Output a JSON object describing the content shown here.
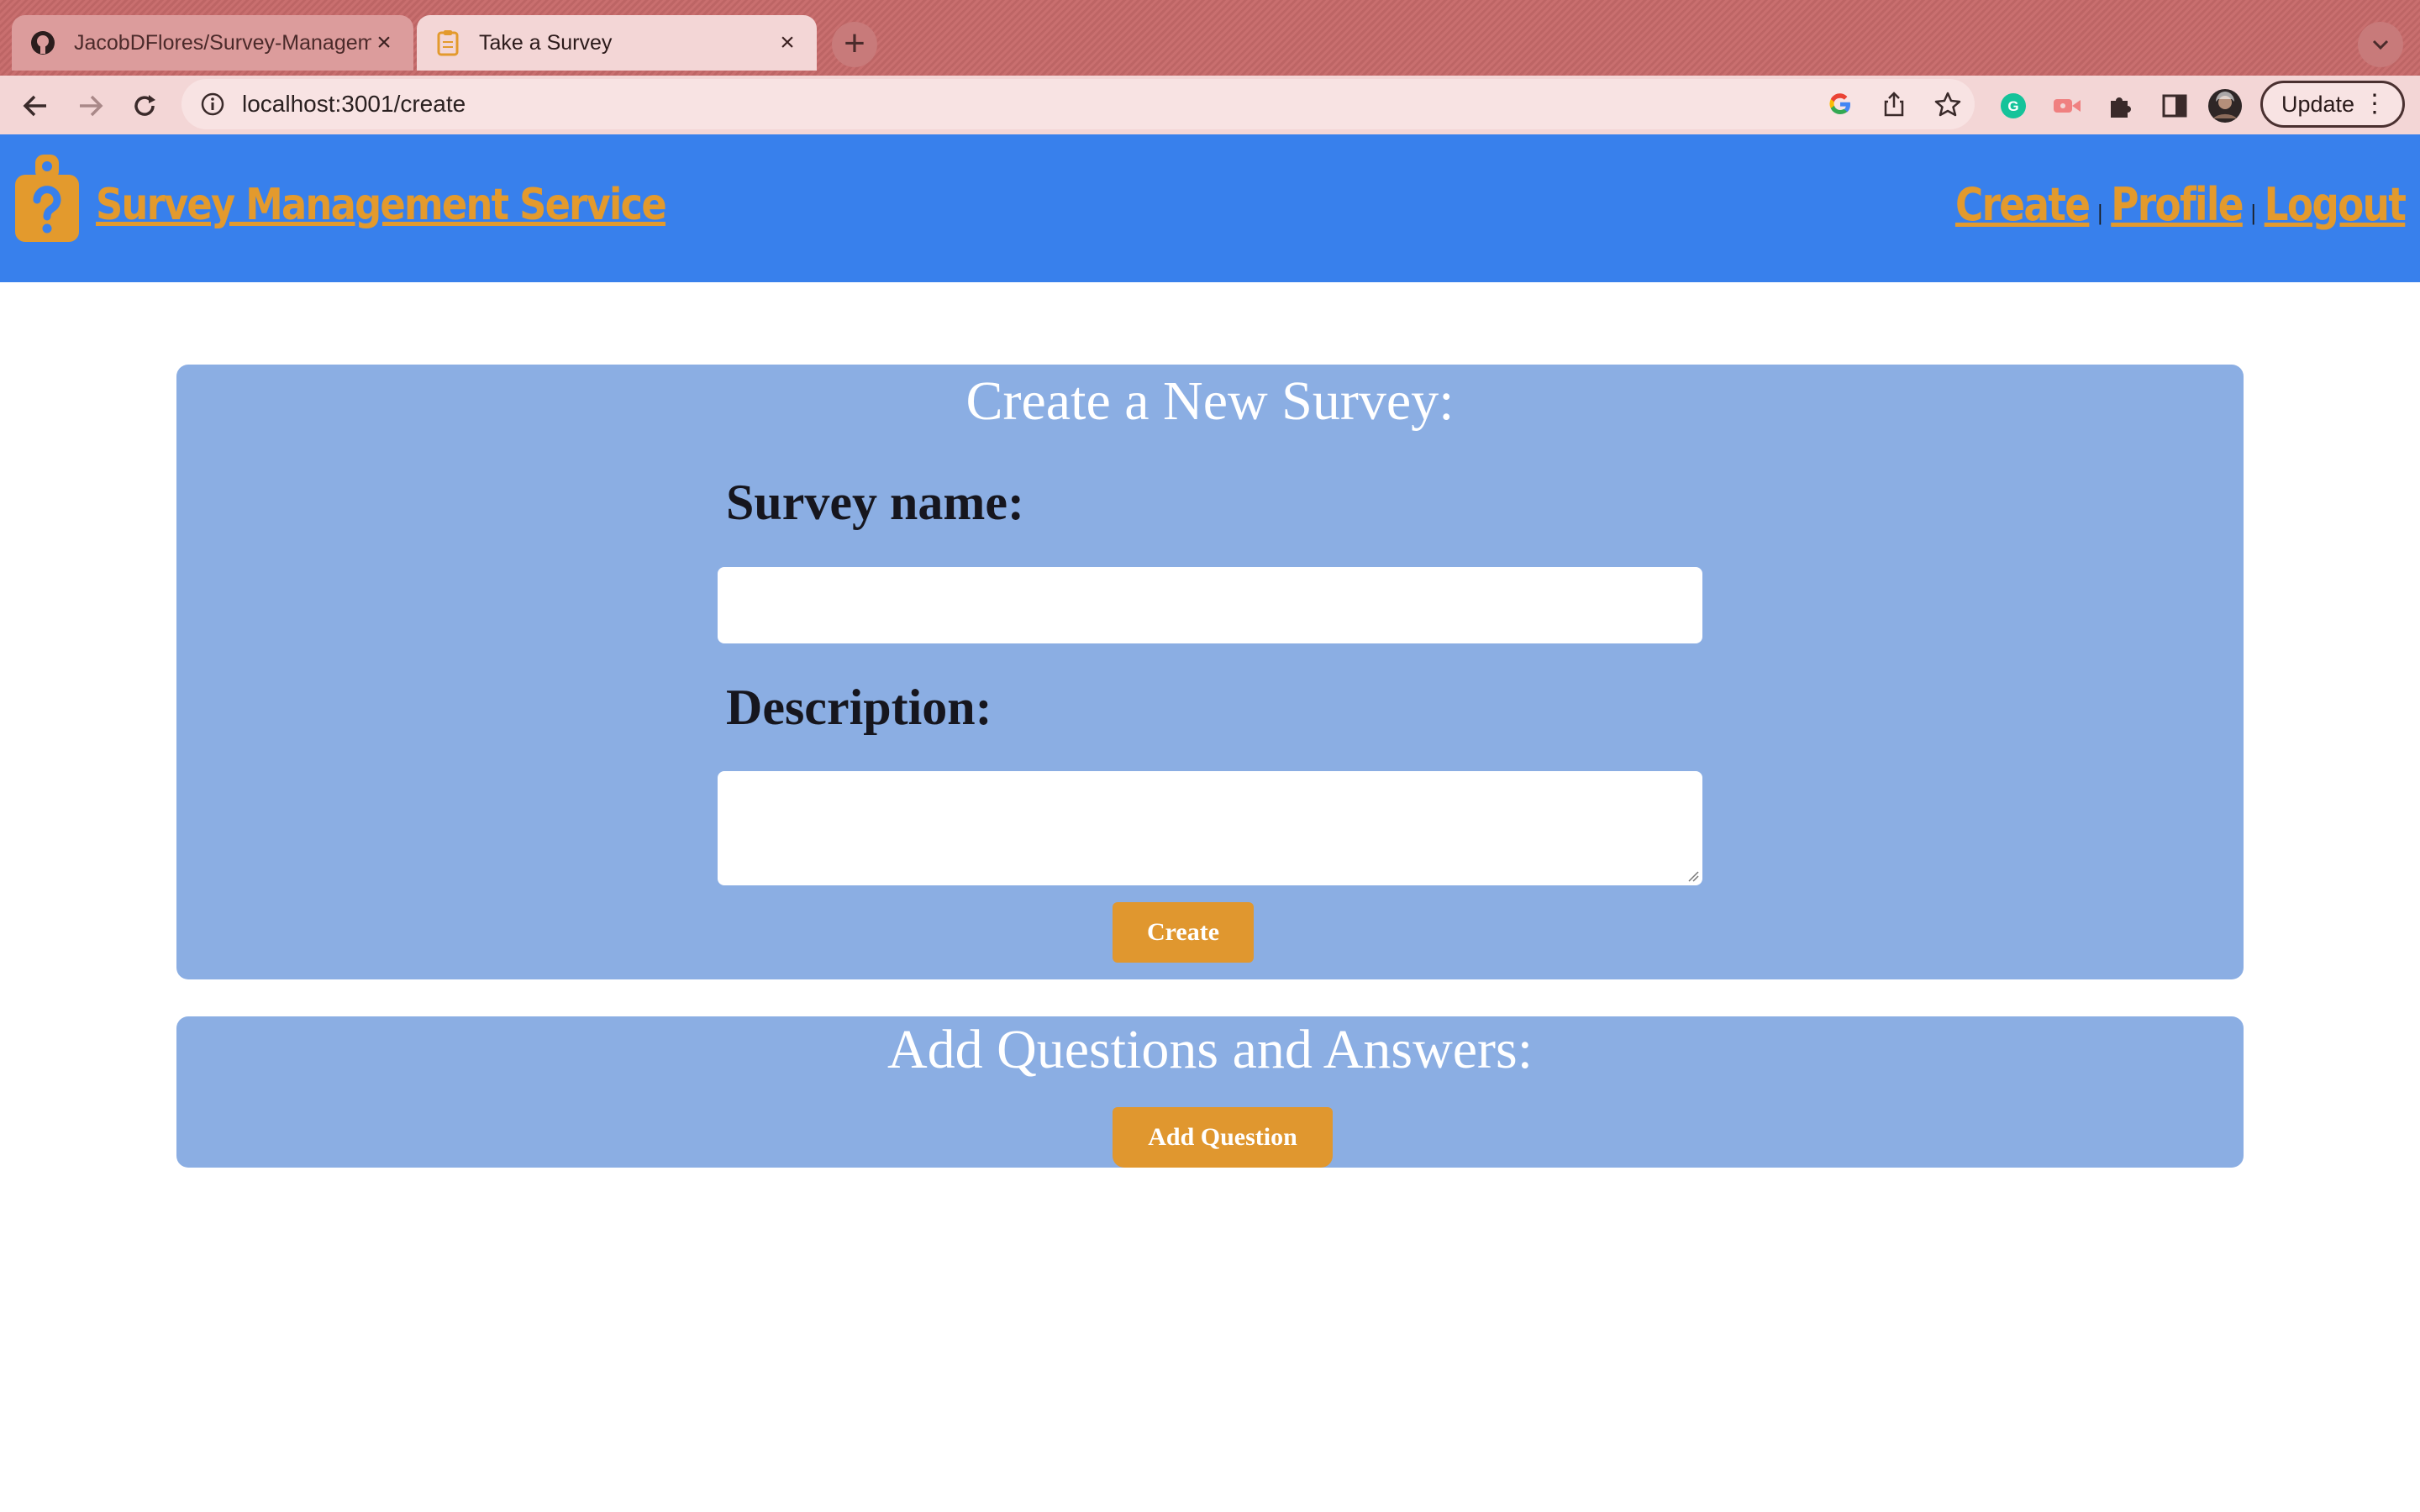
{
  "browser": {
    "tabs": [
      {
        "title": "JacobDFlores/Survey-Managem",
        "favicon": "github-icon",
        "active": false
      },
      {
        "title": "Take a Survey",
        "favicon": "clipboard-icon",
        "active": true
      }
    ],
    "url": "localhost:3001/create",
    "update_label": "Update",
    "accent": "#f3d6d6"
  },
  "header": {
    "title": "Survey Management Service",
    "logo": "clipboard-question-icon",
    "nav": [
      {
        "label": "Create"
      },
      {
        "label": "Profile"
      },
      {
        "label": "Logout"
      }
    ],
    "separator": "|",
    "background": "#3880ec",
    "link_color": "#e39a2d"
  },
  "create_form": {
    "heading": "Create a New Survey:",
    "survey_name_label": "Survey name:",
    "survey_name_value": "",
    "description_label": "Description:",
    "description_value": "",
    "submit_label": "Create"
  },
  "questions": {
    "heading": "Add Questions and Answers:",
    "add_label": "Add Question"
  },
  "colors": {
    "card": "#8baee3",
    "button": "#e0972f"
  }
}
